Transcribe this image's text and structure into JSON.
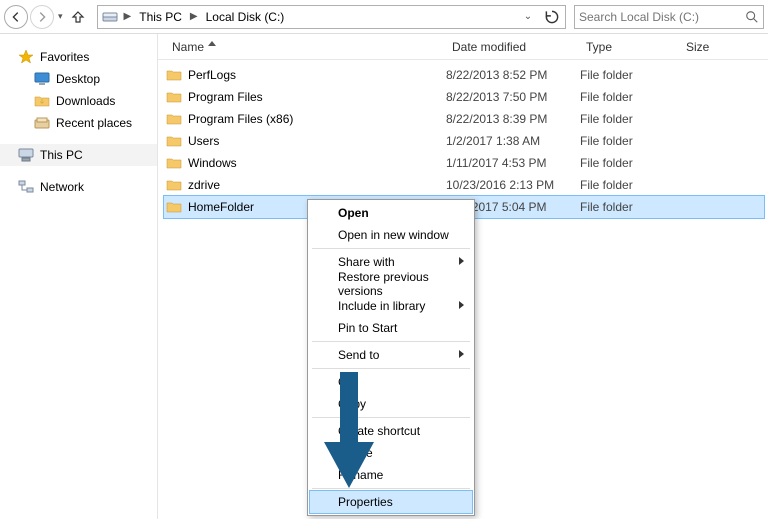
{
  "toolbar": {
    "breadcrumbs": [
      {
        "label": "This PC"
      },
      {
        "label": "Local Disk (C:)"
      }
    ],
    "search_placeholder": "Search Local Disk (C:)"
  },
  "nav": {
    "favorites_label": "Favorites",
    "favorites": [
      {
        "label": "Desktop",
        "icon": "desktop"
      },
      {
        "label": "Downloads",
        "icon": "downloads"
      },
      {
        "label": "Recent places",
        "icon": "recent"
      }
    ],
    "thispc_label": "This PC",
    "network_label": "Network"
  },
  "columns": {
    "name": "Name",
    "date": "Date modified",
    "type": "Type",
    "size": "Size"
  },
  "type_file_folder": "File folder",
  "files": [
    {
      "name": "PerfLogs",
      "date": "8/22/2013 8:52 PM"
    },
    {
      "name": "Program Files",
      "date": "8/22/2013 7:50 PM"
    },
    {
      "name": "Program Files (x86)",
      "date": "8/22/2013 8:39 PM"
    },
    {
      "name": "Users",
      "date": "1/2/2017 1:38 AM"
    },
    {
      "name": "Windows",
      "date": "1/11/2017 4:53 PM"
    },
    {
      "name": "zdrive",
      "date": "10/23/2016 2:13 PM"
    },
    {
      "name": "HomeFolder",
      "date": "1/11/2017 5:04 PM",
      "selected": true
    }
  ],
  "context_menu": [
    {
      "label": "Open",
      "bold": true
    },
    {
      "label": "Open in new window"
    },
    {
      "sep": true
    },
    {
      "label": "Share with",
      "submenu": true
    },
    {
      "label": "Restore previous versions"
    },
    {
      "label": "Include in library",
      "submenu": true
    },
    {
      "label": "Pin to Start"
    },
    {
      "sep": true
    },
    {
      "label": "Send to",
      "submenu": true
    },
    {
      "sep": true
    },
    {
      "label": "Cut"
    },
    {
      "label": "Copy"
    },
    {
      "sep": true
    },
    {
      "label": "Create shortcut"
    },
    {
      "label": "Delete"
    },
    {
      "label": "Rename"
    },
    {
      "sep": true
    },
    {
      "label": "Properties",
      "highlight": true
    }
  ],
  "colors": {
    "selection_bg": "#cde8ff",
    "selection_border": "#7abdf7",
    "pointer_arrow": "#1a5d8a"
  }
}
